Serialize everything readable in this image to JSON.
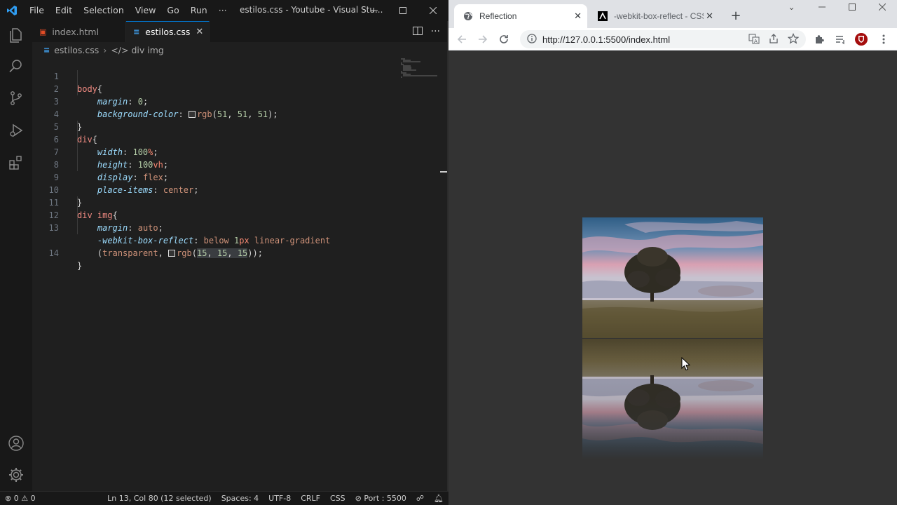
{
  "vscode": {
    "menu": [
      "File",
      "Edit",
      "Selection",
      "View",
      "Go",
      "Run",
      "···"
    ],
    "window_title": "estilos.css - Youtube - Visual Stu...",
    "tabs": [
      {
        "label": "index.html",
        "icon": "html-file-icon",
        "active": false
      },
      {
        "label": "estilos.css",
        "icon": "css-file-icon",
        "active": true
      }
    ],
    "breadcrumb": {
      "file": "estilos.css",
      "symbol": "div img"
    },
    "code_lines": [
      {
        "n": "1",
        "text": "body{"
      },
      {
        "n": "2",
        "text": "    margin: 0;"
      },
      {
        "n": "3",
        "text": "    background-color: rgb(51, 51, 51);"
      },
      {
        "n": "4",
        "text": "}"
      },
      {
        "n": "5",
        "text": "div{"
      },
      {
        "n": "6",
        "text": "    width: 100%;"
      },
      {
        "n": "7",
        "text": "    height: 100vh;"
      },
      {
        "n": "8",
        "text": "    display: flex;"
      },
      {
        "n": "9",
        "text": "    place-items: center;"
      },
      {
        "n": "10",
        "text": "}"
      },
      {
        "n": "11",
        "text": "div img{"
      },
      {
        "n": "12",
        "text": "    margin: auto;"
      },
      {
        "n": "13",
        "text": "    -webkit-box-reflect: below 1px linear-gradient"
      },
      {
        "n": "",
        "text": "    (transparent, rgb(15, 15, 15));"
      },
      {
        "n": "14",
        "text": "}"
      }
    ],
    "status": {
      "problems_errors": "0",
      "problems_warnings": "0",
      "cursor": "Ln 13, Col 80 (12 selected)",
      "spaces": "Spaces: 4",
      "encoding": "UTF-8",
      "eol": "CRLF",
      "language": "CSS",
      "port": "Port : 5500"
    }
  },
  "chrome": {
    "tabs": [
      {
        "title": "Reflection",
        "active": true
      },
      {
        "title": "-webkit-box-reflect - CSS:",
        "active": false
      }
    ],
    "url": "http://127.0.0.1:5500/index.html",
    "page_background": "#333333"
  },
  "colors": {
    "vscode_bg": "#1f1f1f",
    "accent": "#0078d4",
    "selector": "#f28b82",
    "property": "#9cdcfe",
    "number": "#b5cea8"
  }
}
